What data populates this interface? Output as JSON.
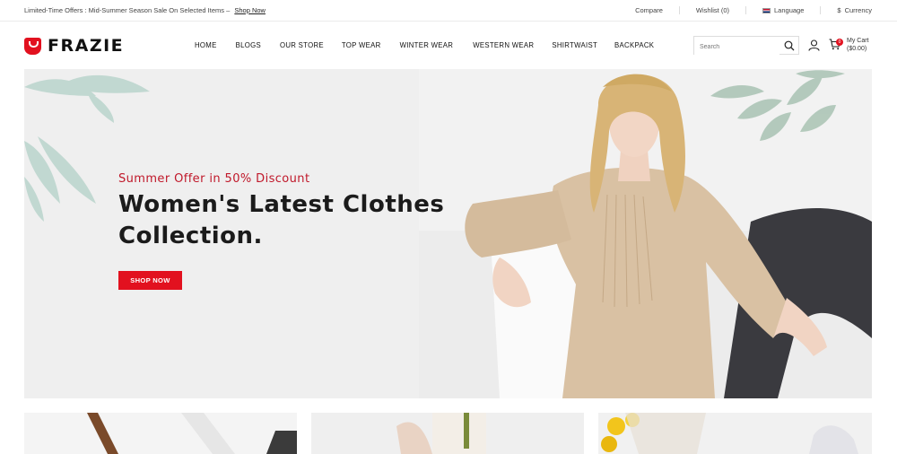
{
  "topbar": {
    "promo_text": "Limited-Time Offers : Mid-Summer Season Sale On Selected Items –",
    "promo_link": "Shop Now",
    "compare": "Compare",
    "wishlist": "Wishlist (0)",
    "language": "Language",
    "currency_symbol": "$",
    "currency": "Currency"
  },
  "brand": {
    "name": "FRAZIE",
    "accent": "#e2111f"
  },
  "nav": {
    "items": [
      {
        "label": "HOME"
      },
      {
        "label": "BLOGS"
      },
      {
        "label": "OUR STORE"
      },
      {
        "label": "TOP WEAR"
      },
      {
        "label": "WINTER WEAR"
      },
      {
        "label": "WESTERN WEAR"
      },
      {
        "label": "SHIRTWAIST"
      },
      {
        "label": "BACKPACK"
      }
    ]
  },
  "search": {
    "placeholder": "Search",
    "icon": "search-icon"
  },
  "account": {
    "icon": "user-icon"
  },
  "cart": {
    "icon": "cart-icon",
    "count": "0",
    "label": "My Cart",
    "total": "($0.00)"
  },
  "hero": {
    "subtitle": "Summer Offer in 50% Discount",
    "title_line1": "Women's Latest Clothes",
    "title_line2": "Collection.",
    "button": "SHOP NOW"
  }
}
